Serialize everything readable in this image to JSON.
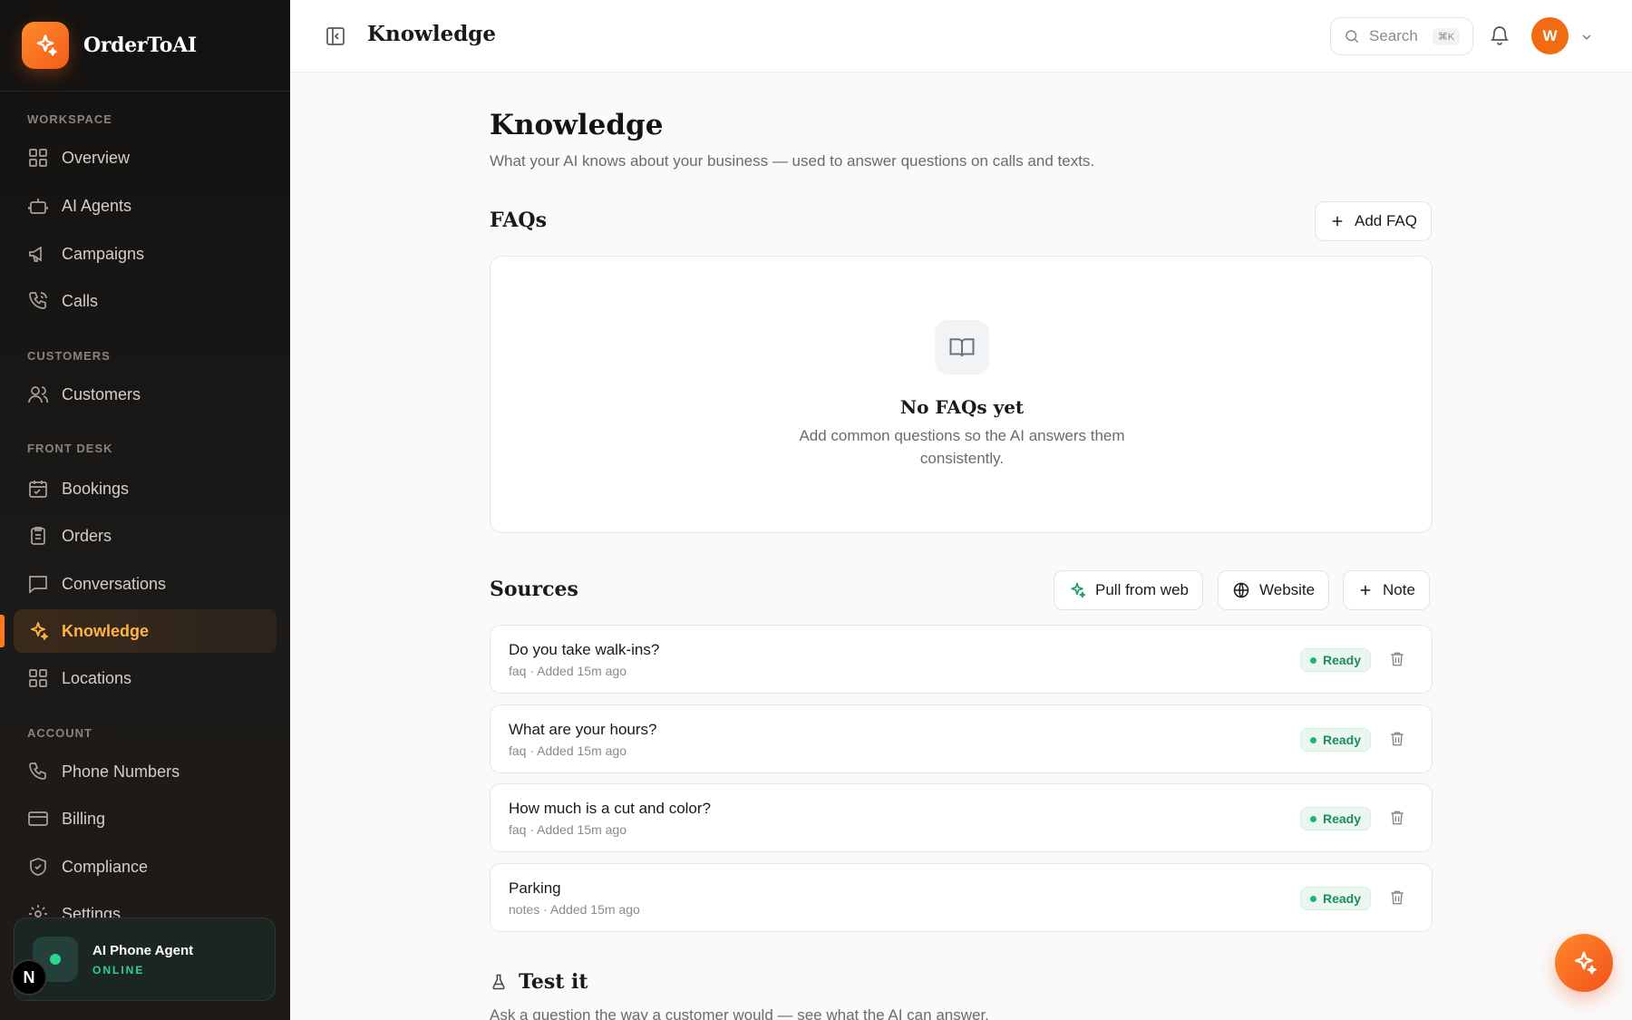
{
  "brand": {
    "name": "OrderToAI"
  },
  "sidebar": {
    "sections": [
      {
        "label": "WORKSPACE"
      },
      {
        "label": "CUSTOMERS"
      },
      {
        "label": "FRONT DESK"
      },
      {
        "label": "ACCOUNT"
      }
    ],
    "items": [
      {
        "label": "Overview",
        "icon": "grid-icon"
      },
      {
        "label": "AI Agents",
        "icon": "robot-icon"
      },
      {
        "label": "Campaigns",
        "icon": "megaphone-icon"
      },
      {
        "label": "Calls",
        "icon": "phone-call-icon"
      },
      {
        "label": "Customers",
        "icon": "users-icon"
      },
      {
        "label": "Bookings",
        "icon": "calendar-icon"
      },
      {
        "label": "Orders",
        "icon": "clipboard-icon"
      },
      {
        "label": "Conversations",
        "icon": "chat-icon"
      },
      {
        "label": "Knowledge",
        "icon": "sparkles-icon",
        "active": true
      },
      {
        "label": "Locations",
        "icon": "grid-icon"
      },
      {
        "label": "Phone Numbers",
        "icon": "phone-icon"
      },
      {
        "label": "Billing",
        "icon": "credit-card-icon"
      },
      {
        "label": "Compliance",
        "icon": "shield-check-icon"
      },
      {
        "label": "Settings",
        "icon": "gear-icon"
      }
    ],
    "agent_card": {
      "title": "AI Phone Agent",
      "status": "ONLINE",
      "avatar_letter": "N"
    }
  },
  "header": {
    "title": "Knowledge",
    "search": {
      "placeholder": "Search",
      "shortcut": "⌘K"
    },
    "user_initial": "W"
  },
  "main": {
    "title": "Knowledge",
    "subtitle": "What your AI knows about your business — used to answer questions on calls and texts.",
    "faqs": {
      "title": "FAQs",
      "add_label": "Add FAQ",
      "empty_title": "No FAQs yet",
      "empty_desc": "Add common questions so the AI answers them consistently."
    },
    "sources": {
      "title": "Sources",
      "buttons": {
        "pull_from_web": "Pull from web",
        "website": "Website",
        "note": "Note"
      },
      "items": [
        {
          "title": "Do you take walk-ins?",
          "meta": "faq · Added 15m ago",
          "status": "Ready"
        },
        {
          "title": "What are your hours?",
          "meta": "faq · Added 15m ago",
          "status": "Ready"
        },
        {
          "title": "How much is a cut and color?",
          "meta": "faq · Added 15m ago",
          "status": "Ready"
        },
        {
          "title": "Parking",
          "meta": "notes · Added 15m ago",
          "status": "Ready"
        }
      ]
    },
    "test": {
      "title": "Test it",
      "desc": "Ask a question the way a customer would — see what the AI can answer."
    }
  },
  "colors": {
    "accent": "#f26a12",
    "ready_green": "#1f8a5b",
    "active_text": "#ffb340"
  }
}
